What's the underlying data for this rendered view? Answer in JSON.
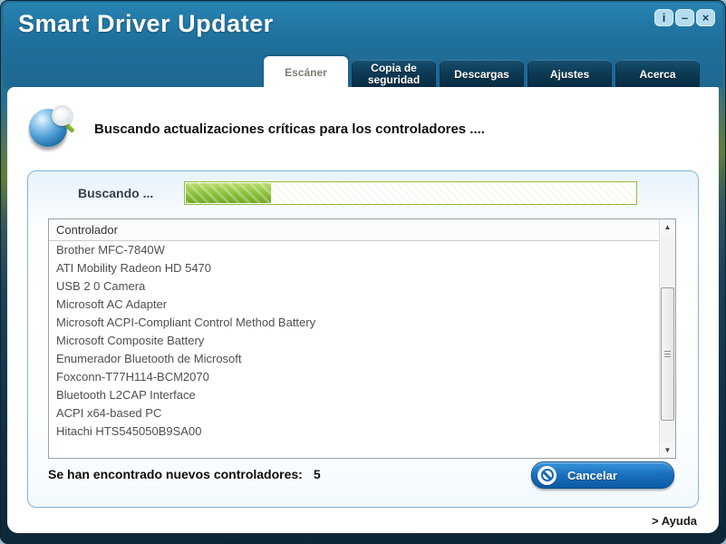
{
  "window": {
    "title": "Smart Driver Updater",
    "controls": {
      "info": "i",
      "minimize": "–",
      "close": "×"
    }
  },
  "tabs": [
    {
      "label": "Escáner",
      "slug": "escaner",
      "active": true
    },
    {
      "label": "Copia de seguridad",
      "slug": "copia-de-seguridad",
      "active": false
    },
    {
      "label": "Descargas",
      "slug": "descargas",
      "active": false
    },
    {
      "label": "Ajustes",
      "slug": "ajustes",
      "active": false
    },
    {
      "label": "Acerca",
      "slug": "acerca",
      "active": false
    }
  ],
  "scan": {
    "heading": "Buscando actualizaciones críticas para los controladores ....",
    "progress_label": "Buscando ...",
    "progress_percent": 19,
    "list_header": "Controlador",
    "drivers": [
      "Brother MFC-7840W",
      "ATI Mobility Radeon HD 5470",
      "USB 2 0 Camera",
      "Microsoft AC Adapter",
      "Microsoft ACPI-Compliant Control Method Battery",
      "Microsoft Composite Battery",
      "Enumerador Bluetooth de Microsoft",
      "Foxconn-T77H114-BCM2070",
      "Bluetooth L2CAP Interface",
      "ACPI x64-based PC",
      "Hitachi HTS545050B9SA00"
    ],
    "found_label": "Se han encontrado nuevos controladores:",
    "found_count": "5",
    "cancel_label": "Cancelar"
  },
  "scrollbar": {
    "up_glyph": "▲",
    "down_glyph": "▼"
  },
  "footer": {
    "help_label": "> Ayuda"
  },
  "colors": {
    "header_teal": "#1f6f9c",
    "tab_navy": "#0c3852",
    "progress_green": "#8cc13d",
    "button_blue": "#1468b8",
    "frame_olive": "#627d3a"
  }
}
